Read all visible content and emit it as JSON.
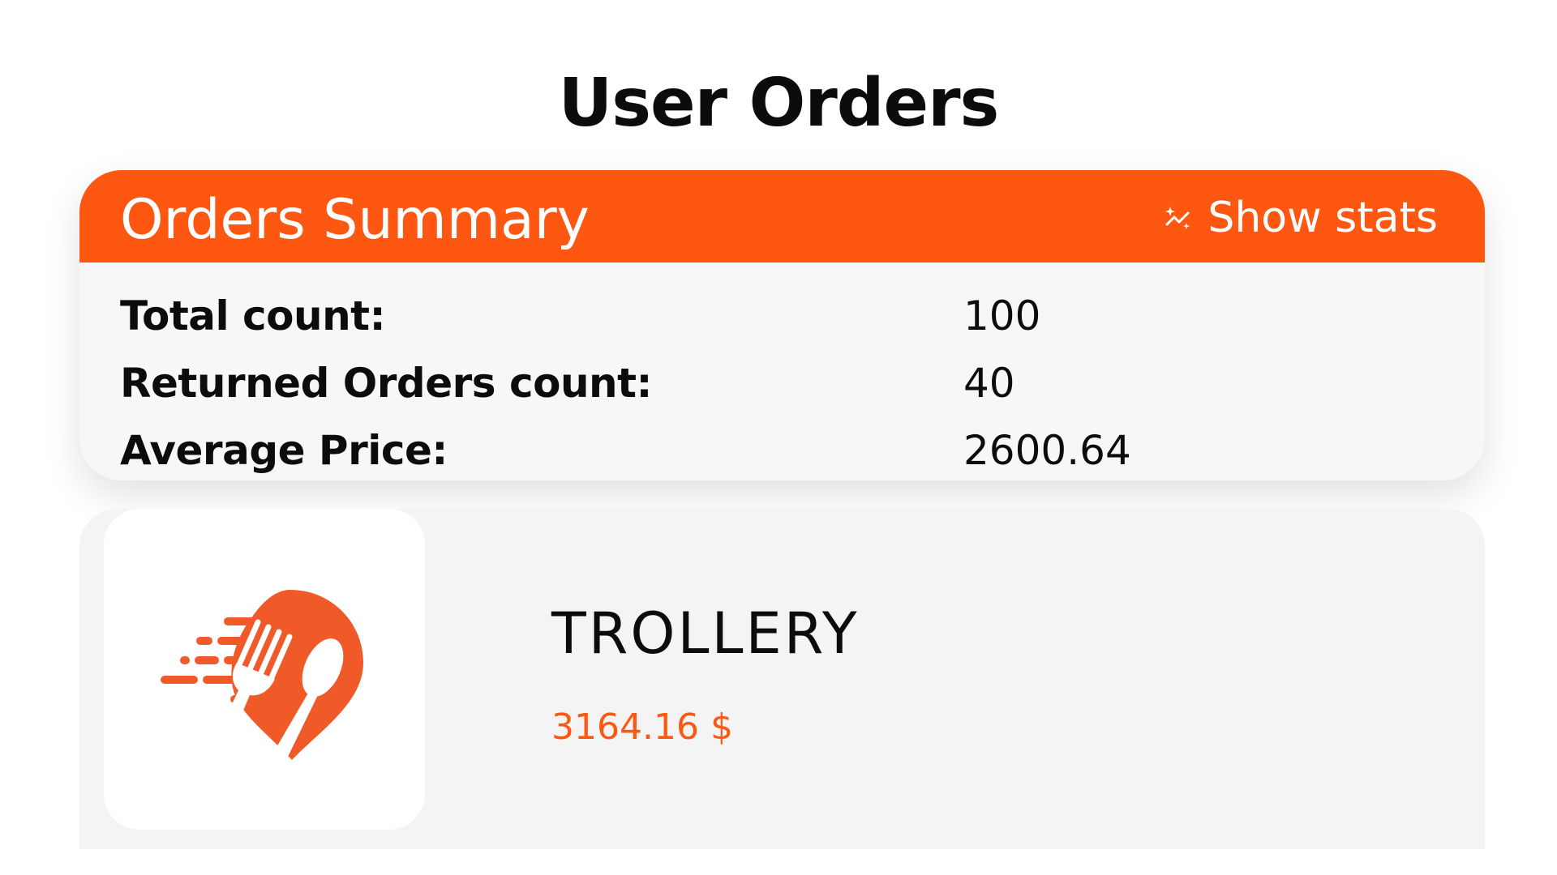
{
  "page": {
    "title": "User Orders"
  },
  "summary": {
    "title": "Orders Summary",
    "show_stats_label": "Show stats",
    "show_stats_icon": "sparkle-chart-icon",
    "rows": [
      {
        "label": "Total count:",
        "value": "100"
      },
      {
        "label": "Returned Orders count:",
        "value": "40"
      },
      {
        "label": "Average Price:",
        "value": "2600.64"
      }
    ]
  },
  "orders": [
    {
      "store_name": "TROLLERY",
      "price": "3164.16 $",
      "logo_icon": "food-delivery-location-icon"
    }
  ],
  "colors": {
    "accent": "#fd5712",
    "card_background": "#f7f7f7",
    "order_background": "#f4f4f4",
    "text": "#0c0c0c"
  }
}
